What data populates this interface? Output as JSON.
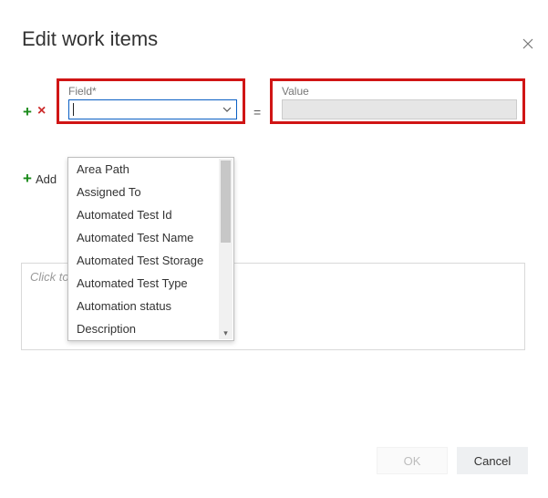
{
  "dialog": {
    "title": "Edit work items"
  },
  "row": {
    "field_label": "Field*",
    "field_value": "",
    "equals": "=",
    "value_label": "Value",
    "value_value": ""
  },
  "icons": {
    "add": "+",
    "remove": "×",
    "add2": "+"
  },
  "add_link": {
    "label": "Add"
  },
  "dropdown": {
    "items": [
      "Area Path",
      "Assigned To",
      "Automated Test Id",
      "Automated Test Name",
      "Automated Test Storage",
      "Automated Test Type",
      "Automation status",
      "Description"
    ]
  },
  "notes": {
    "placeholder": "Click to"
  },
  "buttons": {
    "ok": "OK",
    "cancel": "Cancel"
  }
}
